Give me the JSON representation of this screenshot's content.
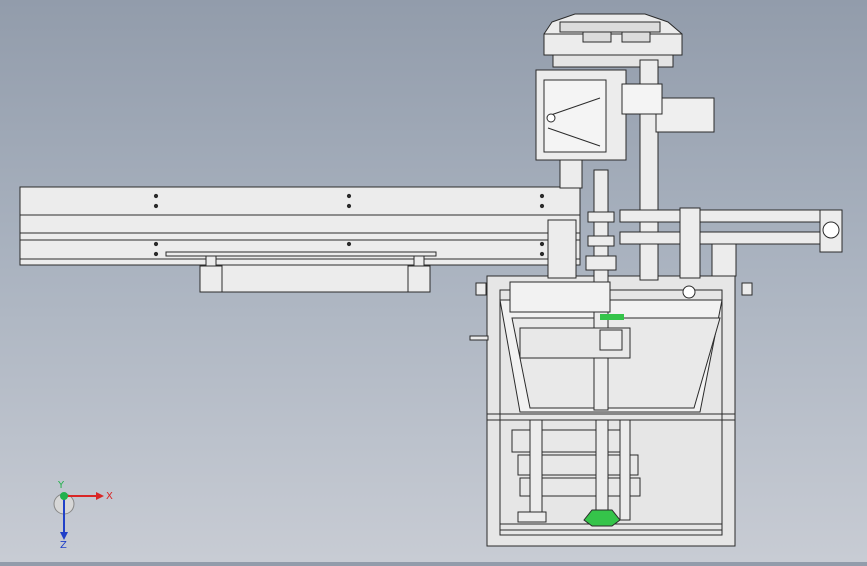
{
  "viewport": {
    "background_top": "#929cab",
    "background_bottom": "#c8ccd4",
    "line_color": "#2b2b2b",
    "part_fill": "#ececec",
    "accent_green": "#35c44a"
  },
  "triad": {
    "x_label": "X",
    "y_label": "Y",
    "z_label": "Z",
    "x_color": "#d92626",
    "y_color": "#22b14c",
    "z_color": "#2040c8"
  }
}
